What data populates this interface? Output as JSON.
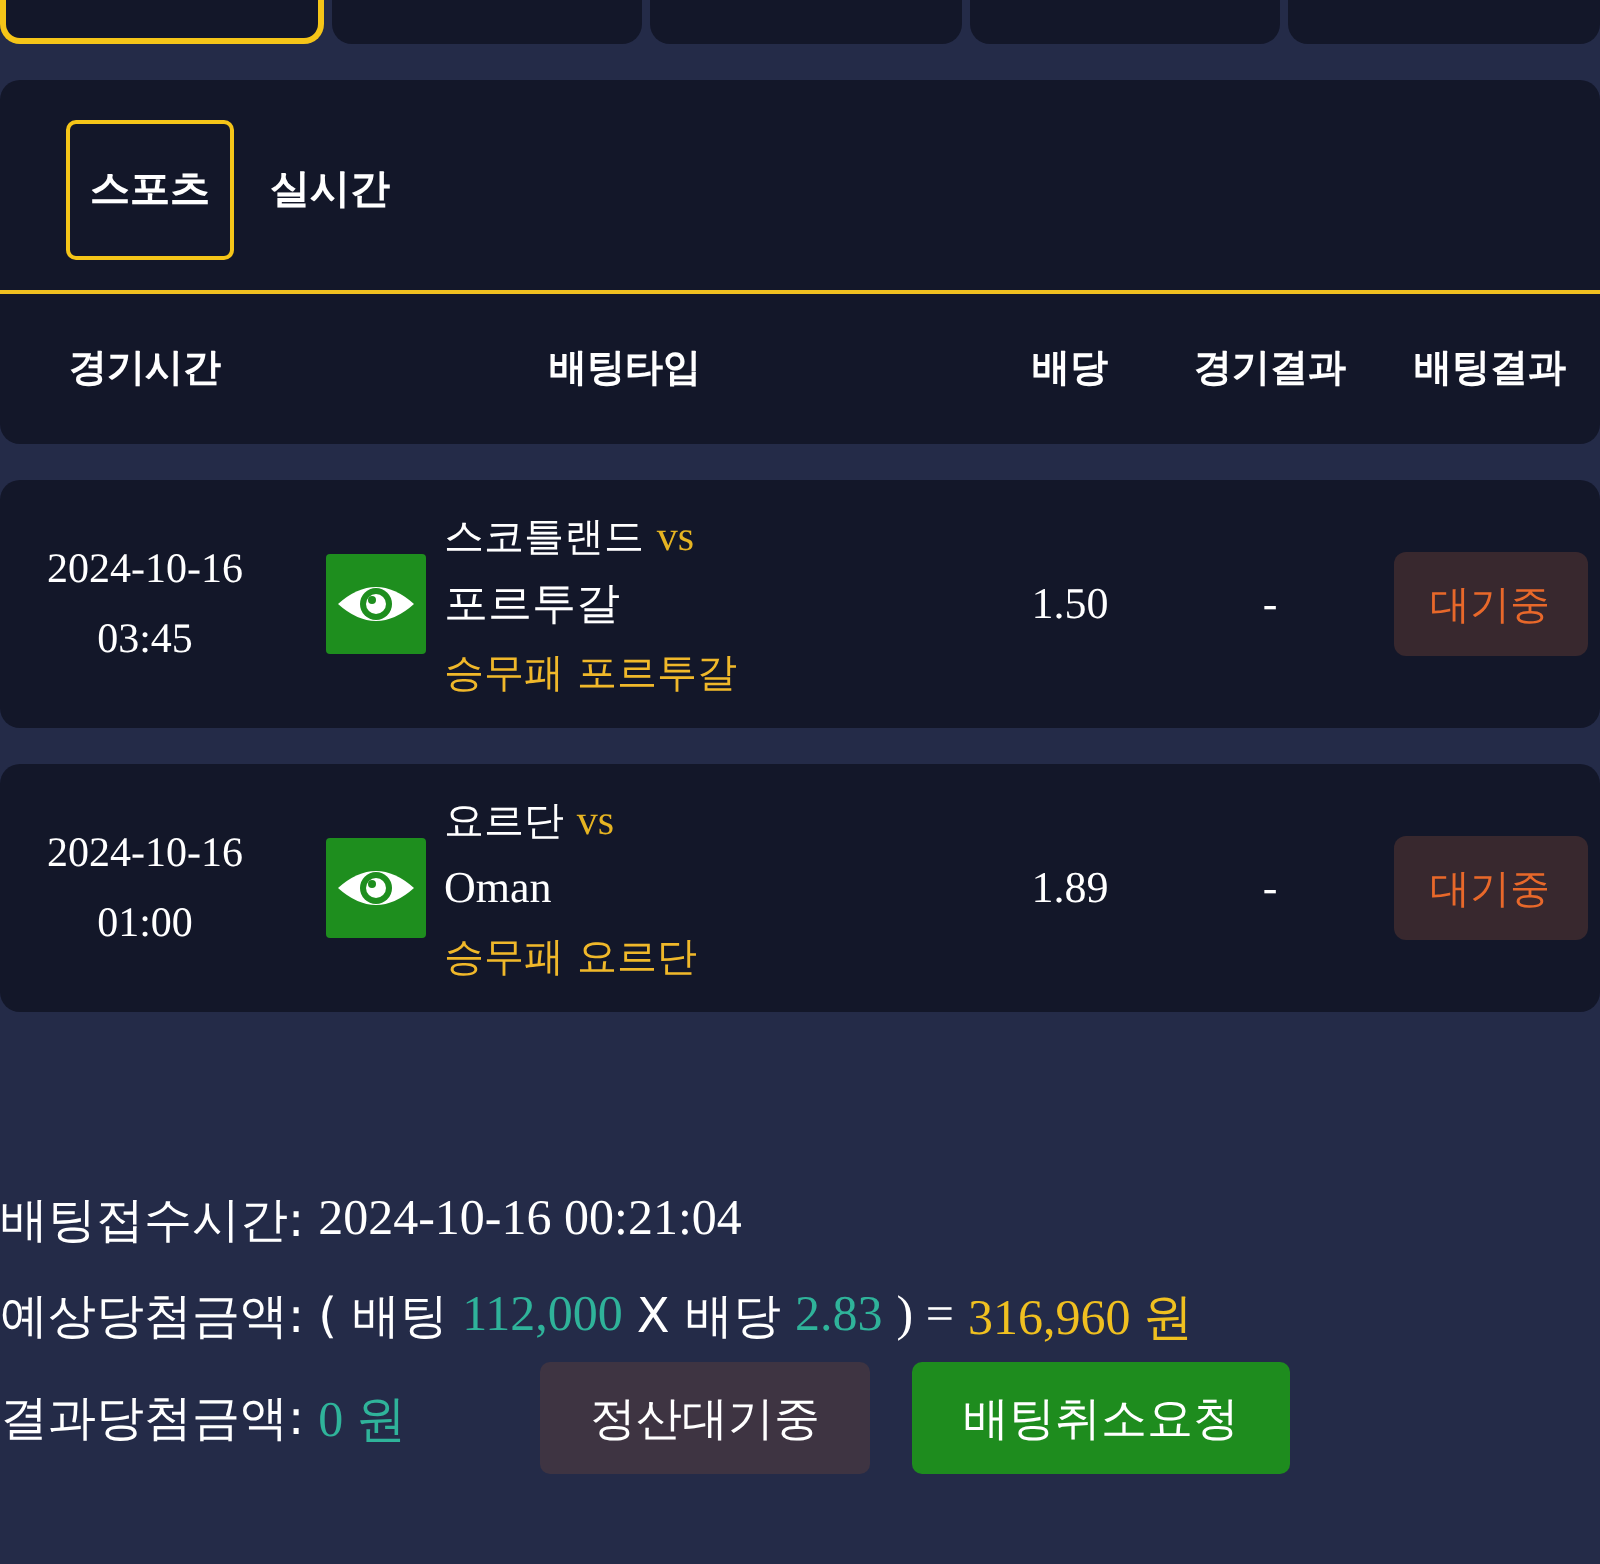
{
  "top_tabs": [
    {
      "selected": true
    },
    {
      "selected": false
    },
    {
      "selected": false
    },
    {
      "selected": false
    },
    {
      "selected": false
    }
  ],
  "sub_tabs": [
    {
      "label": "스포츠",
      "selected": true
    },
    {
      "label": "실시간",
      "selected": false
    }
  ],
  "table": {
    "columns": [
      "경기시간",
      "배팅타입",
      "배당",
      "경기결과",
      "배팅결과"
    ],
    "rows": [
      {
        "date": "2024-10-16",
        "time": "03:45",
        "home": "스코틀랜드",
        "vs": "vs",
        "away": "포르투갈",
        "pick": "승무패 포르투갈",
        "odds": "1.50",
        "game_result": "-",
        "bet_result": "대기중"
      },
      {
        "date": "2024-10-16",
        "time": "01:00",
        "home": "요르단",
        "vs": "vs",
        "away": "Oman",
        "pick": "승무패 요르단",
        "odds": "1.89",
        "game_result": "-",
        "bet_result": "대기중"
      }
    ]
  },
  "summary": {
    "bet_time": {
      "label": "배팅접수시간:",
      "value": "2024-10-16 00:21:04"
    },
    "expected": {
      "label": "예상당첨금액:",
      "open": "( 배팅",
      "stake": "112,000",
      "times": "X 배당",
      "odds": "2.83",
      "close": ") =",
      "payout": "316,960 원"
    },
    "result": {
      "label": "결과당첨금액:",
      "value": "0 원"
    },
    "buttons": [
      {
        "label": "정산대기중",
        "kind": "status"
      },
      {
        "label": "배팅취소요청",
        "kind": "cancel"
      }
    ]
  }
}
